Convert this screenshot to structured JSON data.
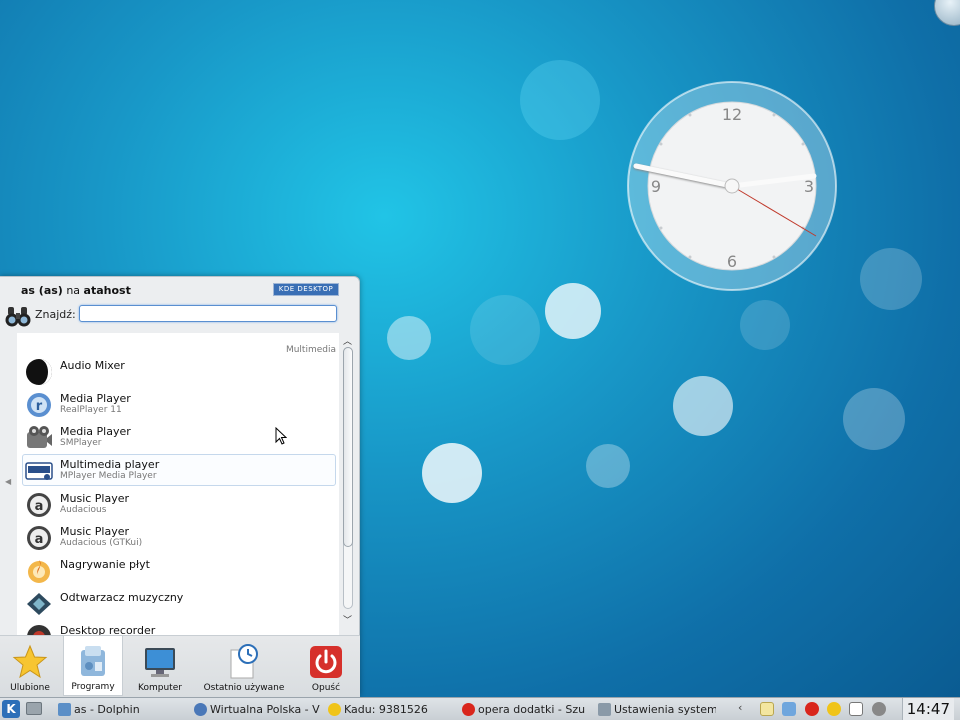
{
  "colors": {
    "accent": "#2c6fb8",
    "selection_border": "#c5d8ec",
    "power": "#d6302b"
  },
  "clock_widget": {
    "numerals": [
      "12",
      "3",
      "6",
      "9"
    ]
  },
  "kickoff": {
    "user_name": "as (as)",
    "user_joiner": "na",
    "host_name": "atahost",
    "badge": "KDE DESKTOP",
    "search_label": "Znajdź:",
    "search_value": "",
    "category": "Multimedia",
    "items": [
      {
        "title": "Audio Mixer",
        "subtitle": "",
        "icon": "audio-mixer-icon"
      },
      {
        "title": "Media Player",
        "subtitle": "RealPlayer 11",
        "icon": "realplayer-icon"
      },
      {
        "title": "Media Player",
        "subtitle": "SMPlayer",
        "icon": "smplayer-icon"
      },
      {
        "title": "Multimedia player",
        "subtitle": "MPlayer Media Player",
        "icon": "mplayer-icon"
      },
      {
        "title": "Music Player",
        "subtitle": "Audacious",
        "icon": "audacious-icon"
      },
      {
        "title": "Music Player",
        "subtitle": "Audacious (GTKui)",
        "icon": "audacious-icon"
      },
      {
        "title": "Nagrywanie płyt",
        "subtitle": "",
        "icon": "disc-burner-icon"
      },
      {
        "title": "Odtwarzacz muzyczny",
        "subtitle": "",
        "icon": "music-player-icon"
      },
      {
        "title": "Desktop recorder",
        "subtitle": "",
        "icon": "recorder-icon"
      }
    ],
    "tabs": [
      {
        "label": "Ulubione",
        "icon": "star-icon"
      },
      {
        "label": "Programy",
        "icon": "applications-icon"
      },
      {
        "label": "Komputer",
        "icon": "computer-icon"
      },
      {
        "label": "Ostatnio używane",
        "icon": "recent-icon"
      },
      {
        "label": "Opuść",
        "icon": "power-icon"
      }
    ]
  },
  "taskbar": {
    "tasks": [
      {
        "label": "as - Dolphin",
        "icon": "dolphin-icon"
      },
      {
        "label": "Wirtualna Polska - V",
        "icon": "browser-icon"
      },
      {
        "label": "Kadu: 9381526",
        "icon": "kadu-icon"
      },
      {
        "label": "opera dodatki - Szu",
        "icon": "opera-icon"
      },
      {
        "label": "Ustawienia systemo",
        "icon": "settings-icon"
      }
    ],
    "time": "14:47"
  }
}
